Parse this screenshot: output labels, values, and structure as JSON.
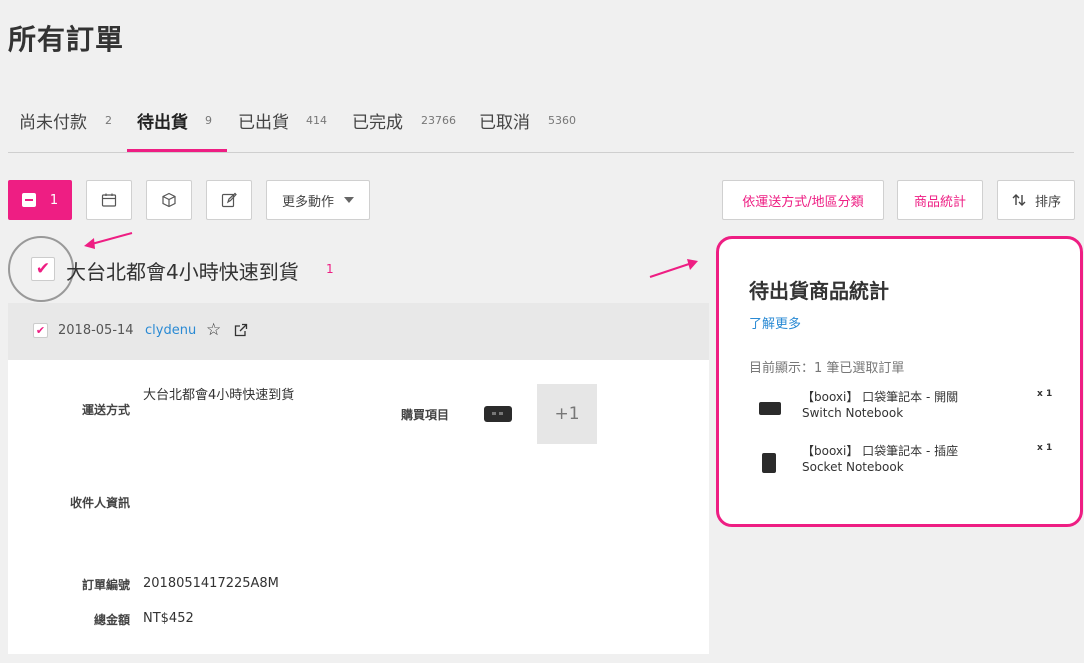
{
  "page": {
    "title": "所有訂單"
  },
  "tabs": [
    {
      "label": "尚未付款",
      "count": "2"
    },
    {
      "label": "待出貨",
      "count": "9"
    },
    {
      "label": "已出貨",
      "count": "414"
    },
    {
      "label": "已完成",
      "count": "23766"
    },
    {
      "label": "已取消",
      "count": "5360"
    }
  ],
  "toolbar": {
    "selected_count": "1",
    "more_actions": "更多動作",
    "group_by_shipping": "依運送方式/地區分類",
    "product_stats": "商品統計",
    "sort": "排序"
  },
  "group": {
    "title": "大台北都會4小時快速到貨",
    "count": "1"
  },
  "order": {
    "date": "2018-05-14",
    "user": "clydenu",
    "shipping_label": "運送方式",
    "shipping_value": "大台北都會4小時快速到貨",
    "items_label": "購買項目",
    "more_items": "+1",
    "recipient_label": "收件人資訊",
    "order_no_label": "訂單編號",
    "order_no": "2018051417225A8M",
    "total_label": "總金額",
    "total": "NT$452"
  },
  "stats_panel": {
    "title": "待出貨商品統計",
    "learn_more": "了解更多",
    "showing": "目前顯示：1 筆已選取訂單",
    "items": [
      {
        "name": "【booxi】 口袋筆記本 - 開關",
        "name_en": "Switch Notebook",
        "qty": "x 1"
      },
      {
        "name": "【booxi】 口袋筆記本 - 插座",
        "name_en": "Socket Notebook",
        "qty": "x 1"
      }
    ]
  },
  "colors": {
    "accent": "#ee1e83",
    "link": "#2a8ad4"
  },
  "icons": [
    "calendar-icon",
    "box-icon",
    "edit-icon",
    "star-icon",
    "external-link-icon",
    "sort-icon",
    "caret-down-icon"
  ]
}
